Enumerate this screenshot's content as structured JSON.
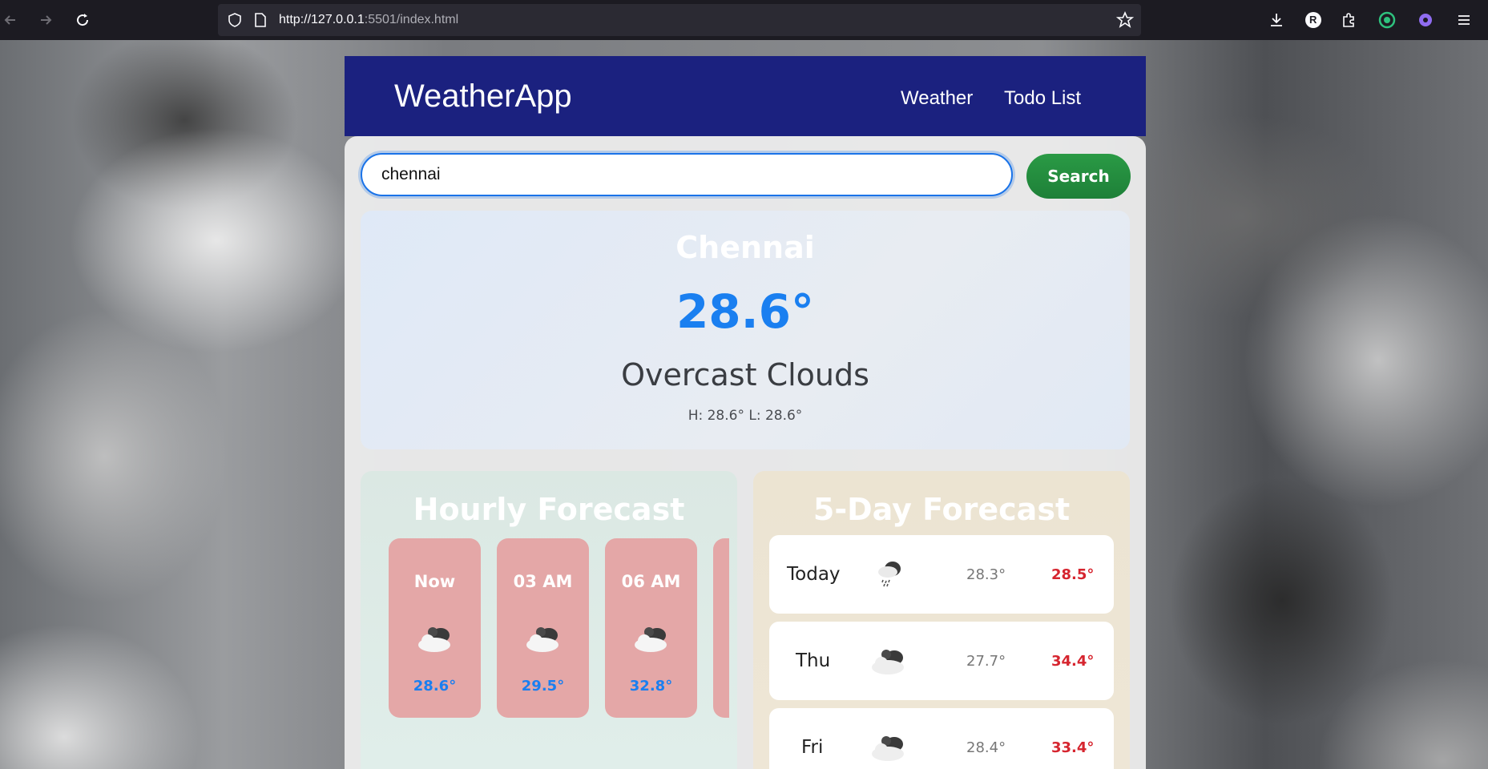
{
  "browser": {
    "url_host": "http://127.0.0.1",
    "url_rest": ":5501/index.html",
    "profile_initial": "R"
  },
  "nav": {
    "brand": "WeatherApp",
    "links": [
      "Weather",
      "Todo List"
    ]
  },
  "search": {
    "value": "chennai",
    "button_label": "Search"
  },
  "current": {
    "city": "Chennai",
    "temp": "28.6°",
    "description": "Overcast Clouds",
    "high_low": "H: 28.6° L: 28.6°"
  },
  "hourly": {
    "title": "Hourly Forecast",
    "items": [
      {
        "time": "Now",
        "icon": "overcast-clouds-icon",
        "temp": "28.6°"
      },
      {
        "time": "03 AM",
        "icon": "overcast-clouds-icon",
        "temp": "29.5°"
      },
      {
        "time": "06 AM",
        "icon": "overcast-clouds-icon",
        "temp": "32.8°"
      }
    ]
  },
  "daily": {
    "title": "5-Day Forecast",
    "items": [
      {
        "day": "Today",
        "icon": "rain-cloud-icon",
        "low": "28.3°",
        "high": "28.5°"
      },
      {
        "day": "Thu",
        "icon": "overcast-clouds-icon",
        "low": "27.7°",
        "high": "34.4°"
      },
      {
        "day": "Fri",
        "icon": "overcast-clouds-icon",
        "low": "28.4°",
        "high": "33.4°"
      }
    ]
  },
  "colors": {
    "navbar": "#1b217f",
    "accent_blue": "#1a7ff0",
    "search_green": "#1e8038",
    "high_red": "#d6252f",
    "hour_card": "#e4a7a7"
  }
}
